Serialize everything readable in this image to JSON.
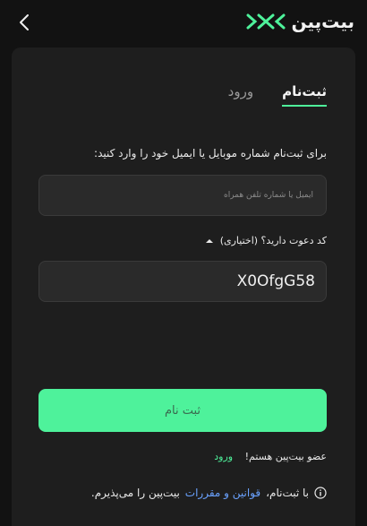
{
  "header": {
    "brand_name": "بیت‌پین",
    "logo_icon": "bitpin-logo-icon",
    "back_icon": "chevron-left-icon"
  },
  "tabs": [
    {
      "label": "ثبت‌نام",
      "active": true
    },
    {
      "label": "ورود",
      "active": false
    }
  ],
  "form": {
    "instruction": "برای ثبت‌نام شماره موبایل یا ایمیل خود را وارد کنید:",
    "email_placeholder": "ایمیل یا شماره تلفن همراه",
    "email_value": "",
    "invite_label": "کد دعوت دارید؟ (اختیاری)",
    "invite_icon": "caret-up-icon",
    "invite_code": "X0OfgG58",
    "submit_label": "ثبت نام"
  },
  "footer": {
    "member_text": "عضو بیت‌پین هستم!",
    "login_link": "ورود",
    "terms_prefix": "با ثبت‌نام،",
    "terms_link": "قوانین و مقررات",
    "terms_suffix": "بیت‌پین را می‌پذیرم.",
    "info_icon": "info-icon"
  },
  "colors": {
    "accent": "#4ef29b",
    "background": "#121212",
    "card": "#1e1e1e",
    "link": "#6aa2ff"
  }
}
